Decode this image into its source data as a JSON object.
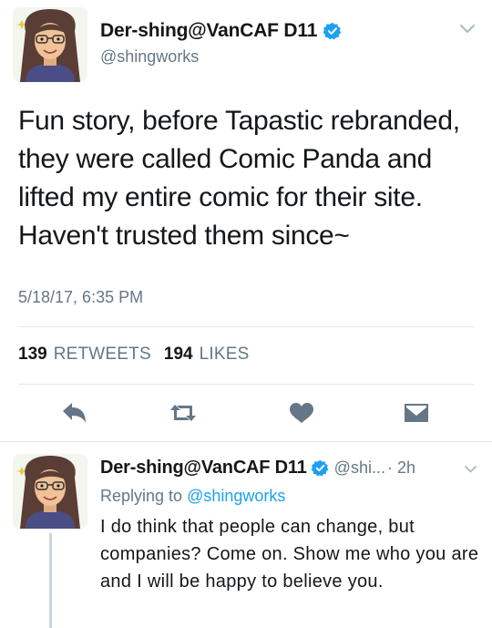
{
  "tweet": {
    "display_name": "Der-shing@VanCAF D11",
    "handle": "@shingworks",
    "text": "Fun story, before Tapastic rebranded, they were called Comic Panda and lifted my entire comic for their site. Haven't trusted them since~",
    "timestamp": "5/18/17, 6:35 PM",
    "retweets_count": "139",
    "retweets_label": "RETWEETS",
    "likes_count": "194",
    "likes_label": "LIKES"
  },
  "actions": {
    "icons": [
      "reply-icon",
      "retweet-icon",
      "like-icon",
      "dm-icon"
    ]
  },
  "reply": {
    "display_name": "Der-shing@VanCAF D11",
    "handle": "@shi...",
    "time": "· 2h",
    "replying_prefix": "Replying to",
    "replying_to": "@shingworks",
    "text": "I do think that people can change, but companies? Come on. Show me who you are and I will be happy to believe you."
  },
  "colors": {
    "text": "#14171a",
    "secondary": "#657786",
    "accent": "#1da1f2",
    "action_icon": "#657786",
    "divider": "#e1e8ed"
  }
}
